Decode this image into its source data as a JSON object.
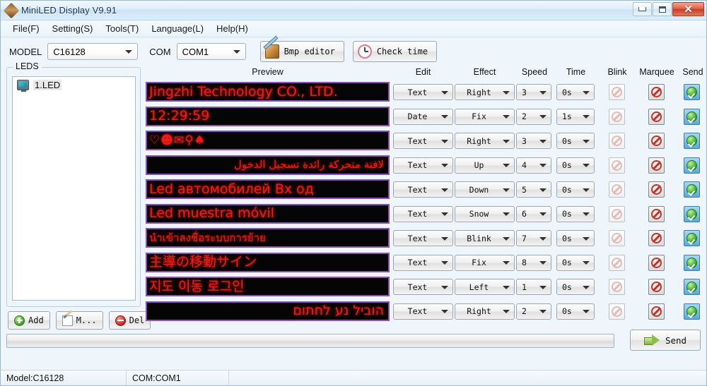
{
  "window": {
    "title": "MiniLED Display V9.91",
    "icon": "diamond-icon",
    "minimize_label": "Minimize",
    "maximize_label": "Maximize",
    "close_label": "Close"
  },
  "menubar": {
    "items": [
      {
        "label": "File(F)",
        "name": "menu-file"
      },
      {
        "label": "Setting(S)",
        "name": "menu-setting"
      },
      {
        "label": "Tools(T)",
        "name": "menu-tools"
      },
      {
        "label": "Language(L)",
        "name": "menu-language"
      },
      {
        "label": "Help(H)",
        "name": "menu-help"
      }
    ]
  },
  "toolbar": {
    "model_label": "MODEL",
    "model_value": "C16128",
    "com_label": "COM",
    "com_value": "COM1",
    "bmp_editor_label": "Bmp editor",
    "check_time_label": "Check time"
  },
  "leds_panel": {
    "legend": "LEDS",
    "items": [
      {
        "label": "1.LED",
        "icon": "monitor-icon"
      }
    ],
    "add_label": "Add",
    "modify_label": "M...",
    "delete_label": "Del"
  },
  "grid": {
    "headers": {
      "preview": "Preview",
      "edit": "Edit",
      "effect": "Effect",
      "speed": "Speed",
      "time": "Time",
      "blink": "Blink",
      "marquee": "Marquee",
      "send": "Send"
    },
    "rows": [
      {
        "preview": "Jingzhi Technology CO., LTD.",
        "script": "latin",
        "edit": "Text",
        "effect": "Right",
        "speed": "3",
        "time": "0s",
        "blink": "disabled",
        "marquee": "off",
        "send": "on"
      },
      {
        "preview": "12:29:59",
        "script": "latin",
        "edit": "Date",
        "effect": "Fix",
        "speed": "2",
        "time": "1s",
        "blink": "disabled",
        "marquee": "off",
        "send": "on"
      },
      {
        "preview": "♡☻✉⚲♠",
        "script": "emoji",
        "edit": "Text",
        "effect": "Right",
        "speed": "3",
        "time": "0s",
        "blink": "disabled",
        "marquee": "off",
        "send": "on"
      },
      {
        "preview": "لافتة متحركة رائدة تسجيل الدخول",
        "script": "rtl",
        "edit": "Text",
        "effect": "Up",
        "speed": "4",
        "time": "0s",
        "blink": "disabled",
        "marquee": "off",
        "send": "on"
      },
      {
        "preview": "Led автомобилей Bx од",
        "script": "latin",
        "edit": "Text",
        "effect": "Down",
        "speed": "5",
        "time": "0s",
        "blink": "disabled",
        "marquee": "off",
        "send": "on"
      },
      {
        "preview": "Led muestra móvil",
        "script": "latin",
        "edit": "Text",
        "effect": "Snow",
        "speed": "6",
        "time": "0s",
        "blink": "disabled",
        "marquee": "off",
        "send": "on"
      },
      {
        "preview": "นำเข้าลงชื่อระบบการย้าย",
        "script": "small",
        "edit": "Text",
        "effect": "Blink",
        "speed": "7",
        "time": "0s",
        "blink": "disabled",
        "marquee": "off",
        "send": "on"
      },
      {
        "preview": "主導の移動サイン",
        "script": "latin",
        "edit": "Text",
        "effect": "Fix",
        "speed": "8",
        "time": "0s",
        "blink": "disabled",
        "marquee": "off",
        "send": "on"
      },
      {
        "preview": "지도 이동 로그인",
        "script": "latin",
        "edit": "Text",
        "effect": "Left",
        "speed": "1",
        "time": "0s",
        "blink": "disabled",
        "marquee": "off",
        "send": "on"
      },
      {
        "preview": "הוביל נע לחתום",
        "script": "rtl2",
        "edit": "Text",
        "effect": "Right",
        "speed": "2",
        "time": "0s",
        "blink": "disabled",
        "marquee": "off",
        "send": "on"
      }
    ]
  },
  "footer": {
    "progress_value": "0",
    "send_label": "Send"
  },
  "statusbar": {
    "model": "Model:C16128",
    "com": "COM:COM1",
    "extra": ""
  },
  "colors": {
    "led_red": "#ee1b18",
    "led_border": "#8a4fb8",
    "window_bg": "#eef6fb",
    "close_red": "#cc3a22"
  }
}
